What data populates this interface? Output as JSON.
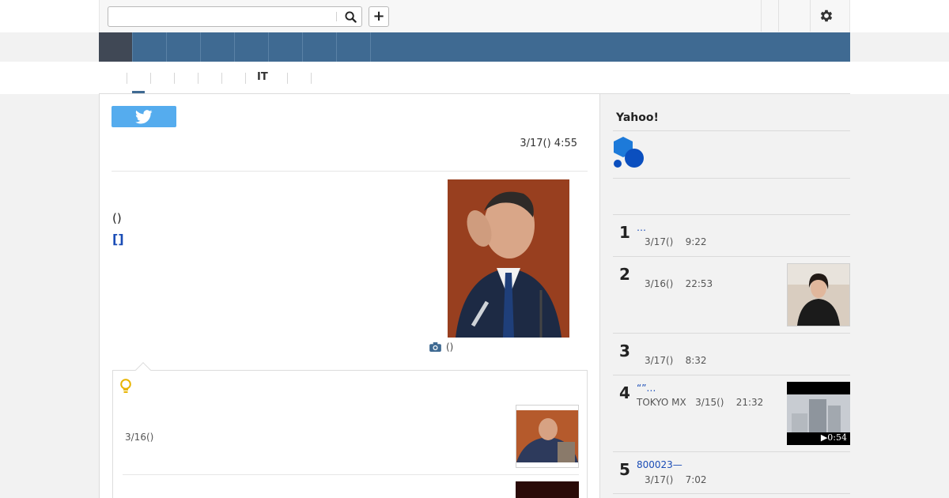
{
  "search": {
    "value": "",
    "placeholder": ""
  },
  "toolbar": {
    "plus_label": "+"
  },
  "subnav": {
    "it_label": "IT"
  },
  "article": {
    "date": "3/17() 4:55",
    "paren_text": "()",
    "bracket_link": "[]",
    "photo_caption": "()"
  },
  "related": {
    "item1_date": "3/16()"
  },
  "sidebar": {
    "title": "Yahoo!",
    "ranking": [
      {
        "rank": "1",
        "title": "…",
        "meta": "3/17()    9:22",
        "has_thumb": false
      },
      {
        "rank": "2",
        "title": "",
        "meta": "3/16()    22:53",
        "has_thumb": true
      },
      {
        "rank": "3",
        "title": "",
        "meta": "3/17()    8:32",
        "has_thumb": false
      },
      {
        "rank": "4",
        "title": "“”…",
        "meta": "TOKYO MX   3/15()    21:32",
        "has_thumb": true,
        "duration": "▶0:54"
      },
      {
        "rank": "5",
        "title": "800023—",
        "meta": "3/17()    7:02",
        "has_thumb": false
      }
    ]
  },
  "colors": {
    "nav": "#3f6a92",
    "nav_active": "#404855",
    "twitter": "#55acee",
    "link": "#1a4cb6",
    "bulb": "#e8b400"
  }
}
